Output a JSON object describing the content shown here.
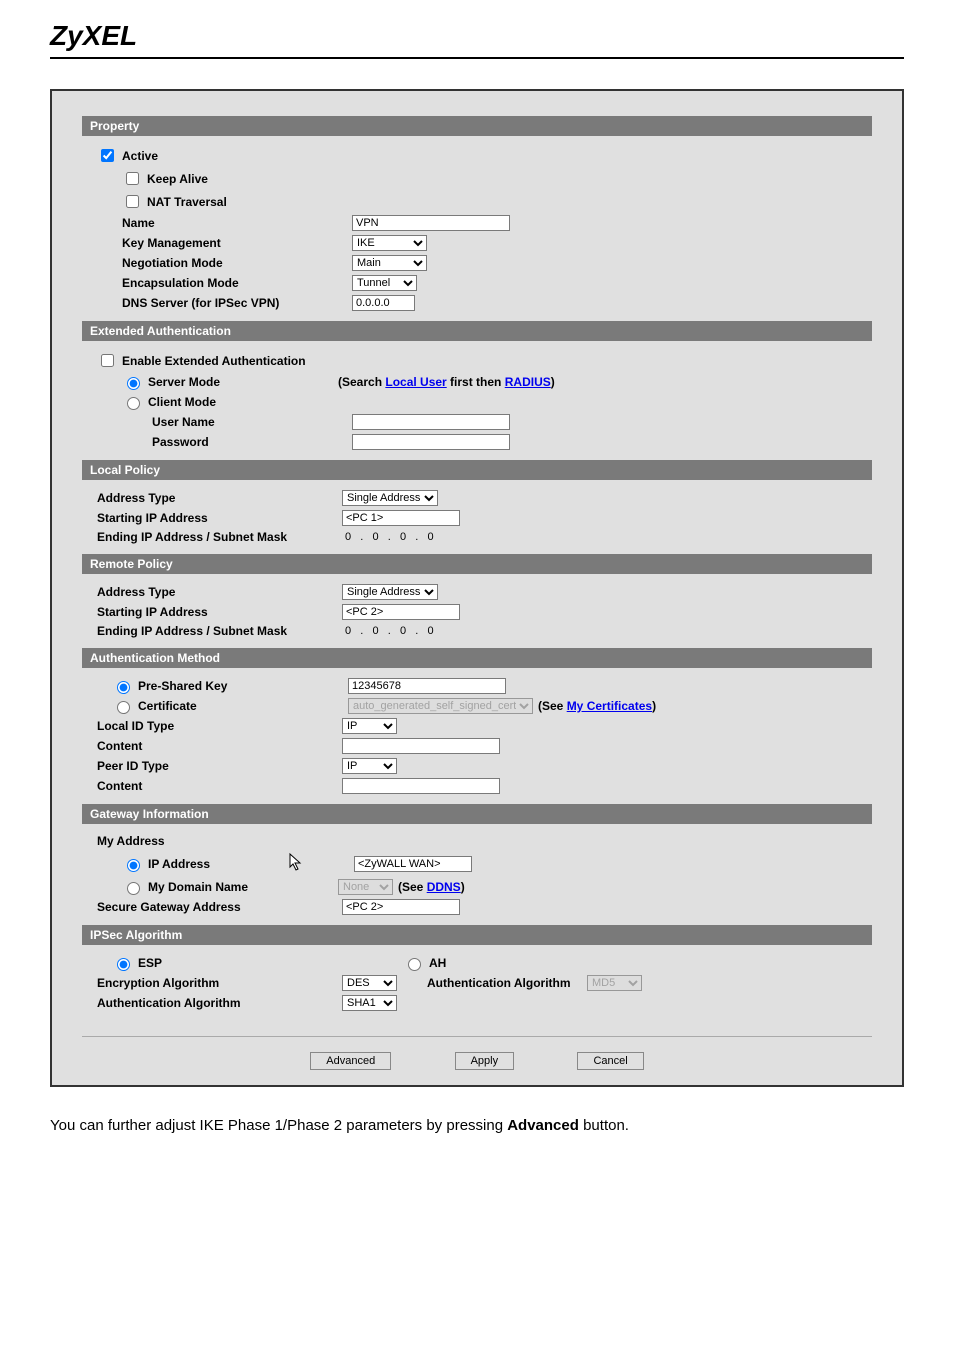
{
  "logo": "ZyXEL",
  "sections": {
    "property": "Property",
    "extAuth": "Extended Authentication",
    "localPolicy": "Local Policy",
    "remotePolicy": "Remote Policy",
    "authMethod": "Authentication Method",
    "gatewayInfo": "Gateway Information",
    "ipsecAlg": "IPSec Algorithm"
  },
  "property": {
    "activeLabel": "Active",
    "keepAliveLabel": "Keep Alive",
    "natTraversalLabel": "NAT Traversal",
    "nameLabel": "Name",
    "nameValue": "VPN",
    "keyMgmtLabel": "Key Management",
    "keyMgmtValue": "IKE",
    "negModeLabel": "Negotiation Mode",
    "negModeValue": "Main",
    "encapModeLabel": "Encapsulation Mode",
    "encapModeValue": "Tunnel",
    "dnsLabel": "DNS Server (for IPSec VPN)",
    "dnsValue": "0.0.0.0"
  },
  "extAuth": {
    "enableLabel": "Enable Extended Authentication",
    "serverModeLabel": "Server Mode",
    "searchNote1": "(Search ",
    "localUserLink": "Local User",
    "searchNote2": " first then ",
    "radiusLink": "RADIUS",
    "searchNote3": ")",
    "clientModeLabel": "Client Mode",
    "userNameLabel": "User Name",
    "passwordLabel": "Password"
  },
  "localPolicy": {
    "addrTypeLabel": "Address Type",
    "addrTypeValue": "Single Address",
    "startIpLabel": "Starting IP Address",
    "startIpValue": "<PC 1>",
    "endIpLabel": "Ending IP Address / Subnet Mask",
    "endIpValue": "0   .   0   .   0   .   0"
  },
  "remotePolicy": {
    "addrTypeLabel": "Address Type",
    "addrTypeValue": "Single Address",
    "startIpLabel": "Starting IP Address",
    "startIpValue": "<PC 2>",
    "endIpLabel": "Ending IP Address / Subnet Mask",
    "endIpValue": "0   .   0   .   0   .   0"
  },
  "authMethod": {
    "pskLabel": "Pre-Shared Key",
    "pskValue": "12345678",
    "certLabel": "Certificate",
    "certValue": "auto_generated_self_signed_cert",
    "seeNote": "(See ",
    "myCertLink": "My Certificates",
    "seeNote2": ")",
    "localIdTypeLabel": "Local ID Type",
    "localIdTypeValue": "IP",
    "contentLabel": "Content",
    "peerIdTypeLabel": "Peer ID Type",
    "peerIdTypeValue": "IP",
    "content2Label": "Content"
  },
  "gatewayInfo": {
    "myAddrLabel": "My Address",
    "ipAddrLabel": "IP Address",
    "ipAddrValue": "<ZyWALL WAN>",
    "domainLabel": "My Domain Name",
    "domainValue": "None",
    "seeNote": "(See ",
    "ddnsLink": "DDNS",
    "seeNote2": ")",
    "secGatewayLabel": "Secure Gateway Address",
    "secGatewayValue": "<PC 2>"
  },
  "ipsecAlg": {
    "espLabel": "ESP",
    "ahLabel": "AH",
    "encAlgLabel": "Encryption Algorithm",
    "encAlgValue": "DES",
    "authAlgRightLabel": "Authentication Algorithm",
    "authAlgRightValue": "MD5",
    "authAlgLabel": "Authentication Algorithm",
    "authAlgValue": "SHA1"
  },
  "buttons": {
    "advanced": "Advanced",
    "apply": "Apply",
    "cancel": "Cancel"
  },
  "footerText": "You can further adjust IKE Phase 1/Phase 2 parameters by pressing ",
  "footerBold": "Advanced",
  "footerText2": " button."
}
